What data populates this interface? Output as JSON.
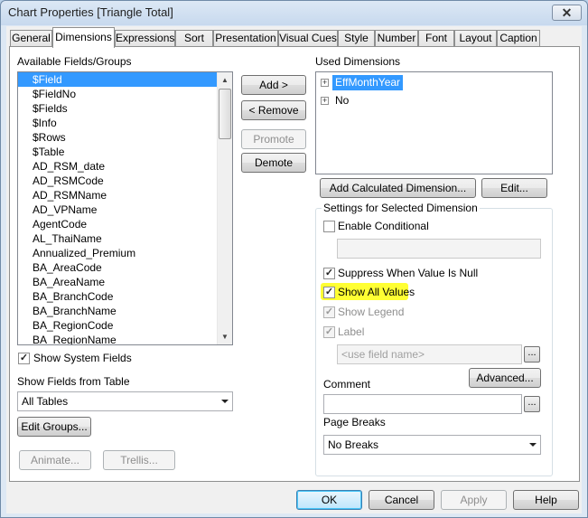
{
  "window": {
    "title": "Chart Properties [Triangle Total]",
    "close_label": "✕"
  },
  "tabs": [
    {
      "label": "General"
    },
    {
      "label": "Dimensions"
    },
    {
      "label": "Expressions"
    },
    {
      "label": "Sort"
    },
    {
      "label": "Presentation"
    },
    {
      "label": "Visual Cues"
    },
    {
      "label": "Style"
    },
    {
      "label": "Number"
    },
    {
      "label": "Font"
    },
    {
      "label": "Layout"
    },
    {
      "label": "Caption"
    }
  ],
  "active_tab": "Dimensions",
  "available": {
    "label": "Available Fields/Groups",
    "items": [
      "$Field",
      "$FieldNo",
      "$Fields",
      "$Info",
      "$Rows",
      "$Table",
      "AD_RSM_date",
      "AD_RSMCode",
      "AD_RSMName",
      "AD_VPName",
      "AgentCode",
      "AL_ThaiName",
      "Annualized_Premium",
      "BA_AreaCode",
      "BA_AreaName",
      "BA_BranchCode",
      "BA_BranchName",
      "BA_RegionCode",
      "BA_RegionName"
    ],
    "selected": "$Field",
    "show_system_fields": "Show System Fields",
    "show_fields_label": "Show Fields from Table",
    "table_value": "All Tables",
    "edit_groups": "Edit Groups...",
    "animate": "Animate...",
    "trellis": "Trellis..."
  },
  "middle_buttons": {
    "add": "Add >",
    "remove": "< Remove",
    "promote": "Promote",
    "demote": "Demote"
  },
  "used": {
    "label": "Used Dimensions",
    "items": [
      {
        "label": "EffMonthYear",
        "expander": "+",
        "selected": true
      },
      {
        "label": "No",
        "expander": "+",
        "selected": false
      }
    ],
    "add_calculated": "Add Calculated Dimension...",
    "edit": "Edit..."
  },
  "settings": {
    "title": "Settings for Selected Dimension",
    "enable_conditional": "Enable Conditional",
    "suppress": "Suppress When Value Is Null",
    "show_all_values": "Show All Values",
    "show_legend": "Show Legend",
    "label": "Label",
    "label_placeholder": "<use field name>",
    "advanced": "Advanced...",
    "comment": "Comment",
    "page_breaks": "Page Breaks",
    "page_breaks_value": "No Breaks",
    "ellipsis": "..."
  },
  "checks": {
    "mark": "✓"
  },
  "scroll": {
    "up": "▲",
    "down": "▼",
    "combo": "▼"
  },
  "footer": {
    "ok": "OK",
    "cancel": "Cancel",
    "apply": "Apply",
    "help": "Help"
  }
}
